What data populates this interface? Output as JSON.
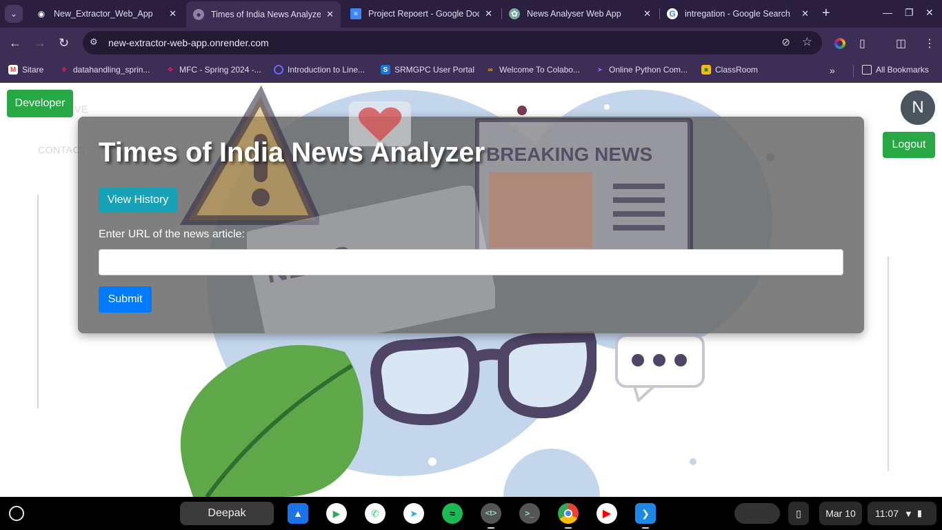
{
  "browser": {
    "tabs": [
      {
        "title": "New_Extractor_Web_App",
        "icon": "render-icon",
        "active": false
      },
      {
        "title": "Times of India News Analyzer",
        "icon": "globe-icon",
        "active": true
      },
      {
        "title": "Project Repoert - Google Docs",
        "icon": "google-docs-icon",
        "active": false
      },
      {
        "title": "News Analyser Web App",
        "icon": "openai-icon",
        "active": false
      },
      {
        "title": "intregation - Google Search",
        "icon": "google-icon",
        "active": false
      }
    ],
    "address": "new-extractor-web-app.onrender.com",
    "bookmarks": [
      {
        "label": "Sitare",
        "icon": "gmail-icon"
      },
      {
        "label": "datahandling_sprin...",
        "icon": "slack-icon"
      },
      {
        "label": "MFC - Spring 2024 -...",
        "icon": "slack-icon"
      },
      {
        "label": "Introduction to Line...",
        "icon": "search-q-icon"
      },
      {
        "label": "SRMGPC User Portal",
        "icon": "s-icon"
      },
      {
        "label": "Welcome To Colabo...",
        "icon": "colab-icon"
      },
      {
        "label": "Online Python Com...",
        "icon": "python-icon"
      },
      {
        "label": "ClassRoom",
        "icon": "classroom-icon"
      }
    ],
    "all_bookmarks": "All Bookmarks"
  },
  "page": {
    "developer_button": "Developer",
    "avatar_letter": "N",
    "logout_button": "Logout",
    "faded_nav": [
      "VE",
      "CONTACT US"
    ],
    "title": "Times of India News Analyzer",
    "history_button": "View History",
    "url_label": "Enter URL of the news article:",
    "url_value": "",
    "submit_button": "Submit"
  },
  "taskbar": {
    "user": "Deepak",
    "date": "Mar 10",
    "time": "11:07",
    "apps": [
      "files-icon",
      "play-store-icon",
      "whatsapp-icon",
      "telegram-icon",
      "spotify-icon",
      "text-editor-icon",
      "terminal-icon",
      "chrome-icon",
      "youtube-icon",
      "vscode-icon"
    ]
  },
  "colors": {
    "tab_bg": "#2b1f3f",
    "toolbar_bg": "#3c2e55",
    "success": "#28a745",
    "info": "#17a2b8",
    "primary": "#007bff",
    "illustration_blue": "#c4d6ec"
  }
}
